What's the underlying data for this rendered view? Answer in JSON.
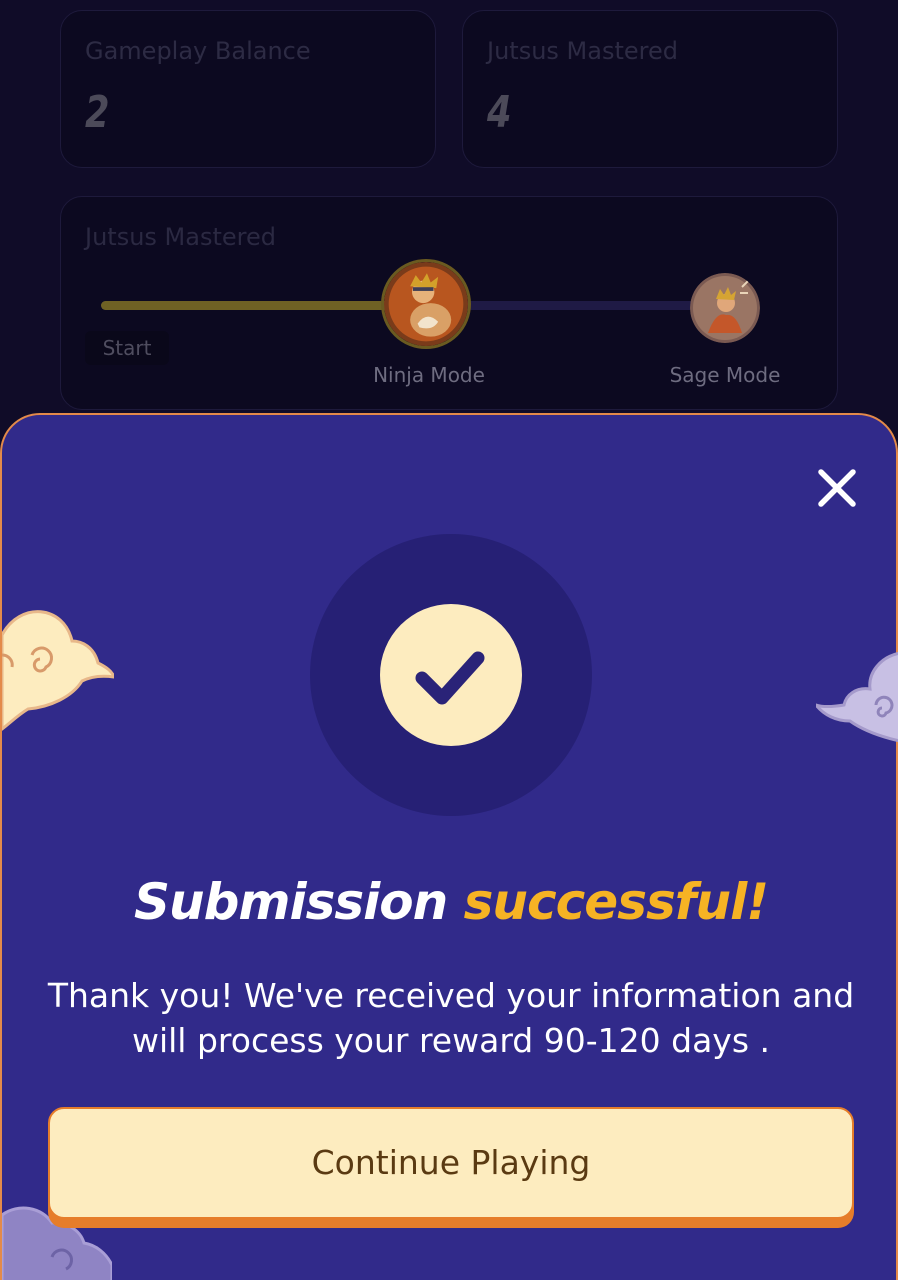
{
  "stats": [
    {
      "label": "Gameplay Balance",
      "value": "2"
    },
    {
      "label": "Jutsus Mastered",
      "value": "4"
    }
  ],
  "progress": {
    "title": "Jutsus Mastered",
    "fill_fraction": 0.48,
    "start_label": "Start",
    "milestones": [
      {
        "label": "Ninja Mode",
        "avatar_icon": "ninja-mode-avatar-icon"
      },
      {
        "label": "Sage Mode",
        "avatar_icon": "sage-mode-avatar-icon"
      }
    ]
  },
  "modal": {
    "close_icon": "close-icon",
    "success_icon": "checkmark-icon",
    "heading_part1": "Submission",
    "heading_part2": "successful!",
    "message": "Thank you! We've received your information and will process your reward 90-120 days .",
    "cta_label": "Continue Playing"
  },
  "colors": {
    "sheet_bg": "#312a8a",
    "sheet_border": "#e38a4a",
    "accent": "#f6b324",
    "button_bg": "#fdecbf",
    "button_border": "#e67d2a",
    "button_text": "#5a3a12",
    "check_halo": "#262075"
  }
}
